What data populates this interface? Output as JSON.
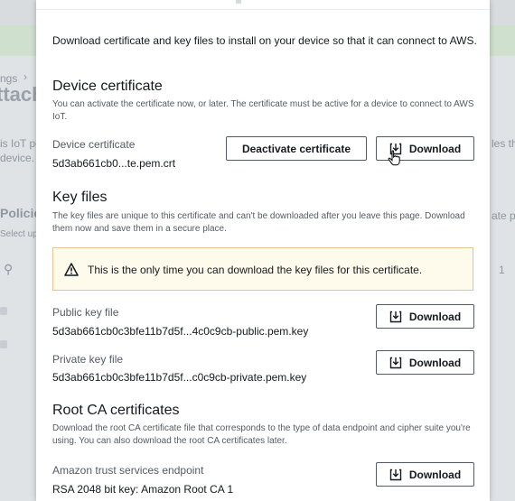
{
  "background": {
    "breadcrumb_fragment": "ngs",
    "title_fragment": "ttach",
    "left_fragment_1": "is IoT po",
    "left_fragment_2": "device.",
    "right_fragment": "les the",
    "policies_fragment": "Policie",
    "select_fragment": "Select up",
    "right_button_fragment": "ate po",
    "page_number": "1"
  },
  "modal": {
    "intro": "Download certificate and key files to install on your device so that it can connect to AWS.",
    "device_certificate": {
      "heading": "Device certificate",
      "description": "You can activate the certificate now, or later. The certificate must be active for a device to connect to AWS IoT.",
      "label": "Device certificate",
      "filename": "5d3ab661cb0...te.pem.crt",
      "deactivate_label": "Deactivate certificate",
      "download_label": "Download"
    },
    "key_files": {
      "heading": "Key files",
      "description": "The key files are unique to this certificate and can't be downloaded after you leave this page. Download them now and save them in a secure place.",
      "alert": "This is the only time you can download the key files for this certificate.",
      "public": {
        "label": "Public key file",
        "filename": "5d3ab661cb0c3bfe11b7d5f...4c0c9cb-public.pem.key",
        "download_label": "Download"
      },
      "private": {
        "label": "Private key file",
        "filename": "5d3ab661cb0c3bfe11b7d5f...c0c9cb-private.pem.key",
        "download_label": "Download"
      }
    },
    "root_ca": {
      "heading": "Root CA certificates",
      "description": "Download the root CA certificate file that corresponds to the type of data endpoint and cipher suite you're using. You can also download the root CA certificates later.",
      "label": "Amazon trust services endpoint",
      "filename": "RSA 2048 bit key: Amazon Root CA 1",
      "download_label": "Download"
    }
  },
  "colors": {
    "alert_background": "#fefaec",
    "alert_border": "#e0c58f",
    "warning": "#16191f"
  }
}
